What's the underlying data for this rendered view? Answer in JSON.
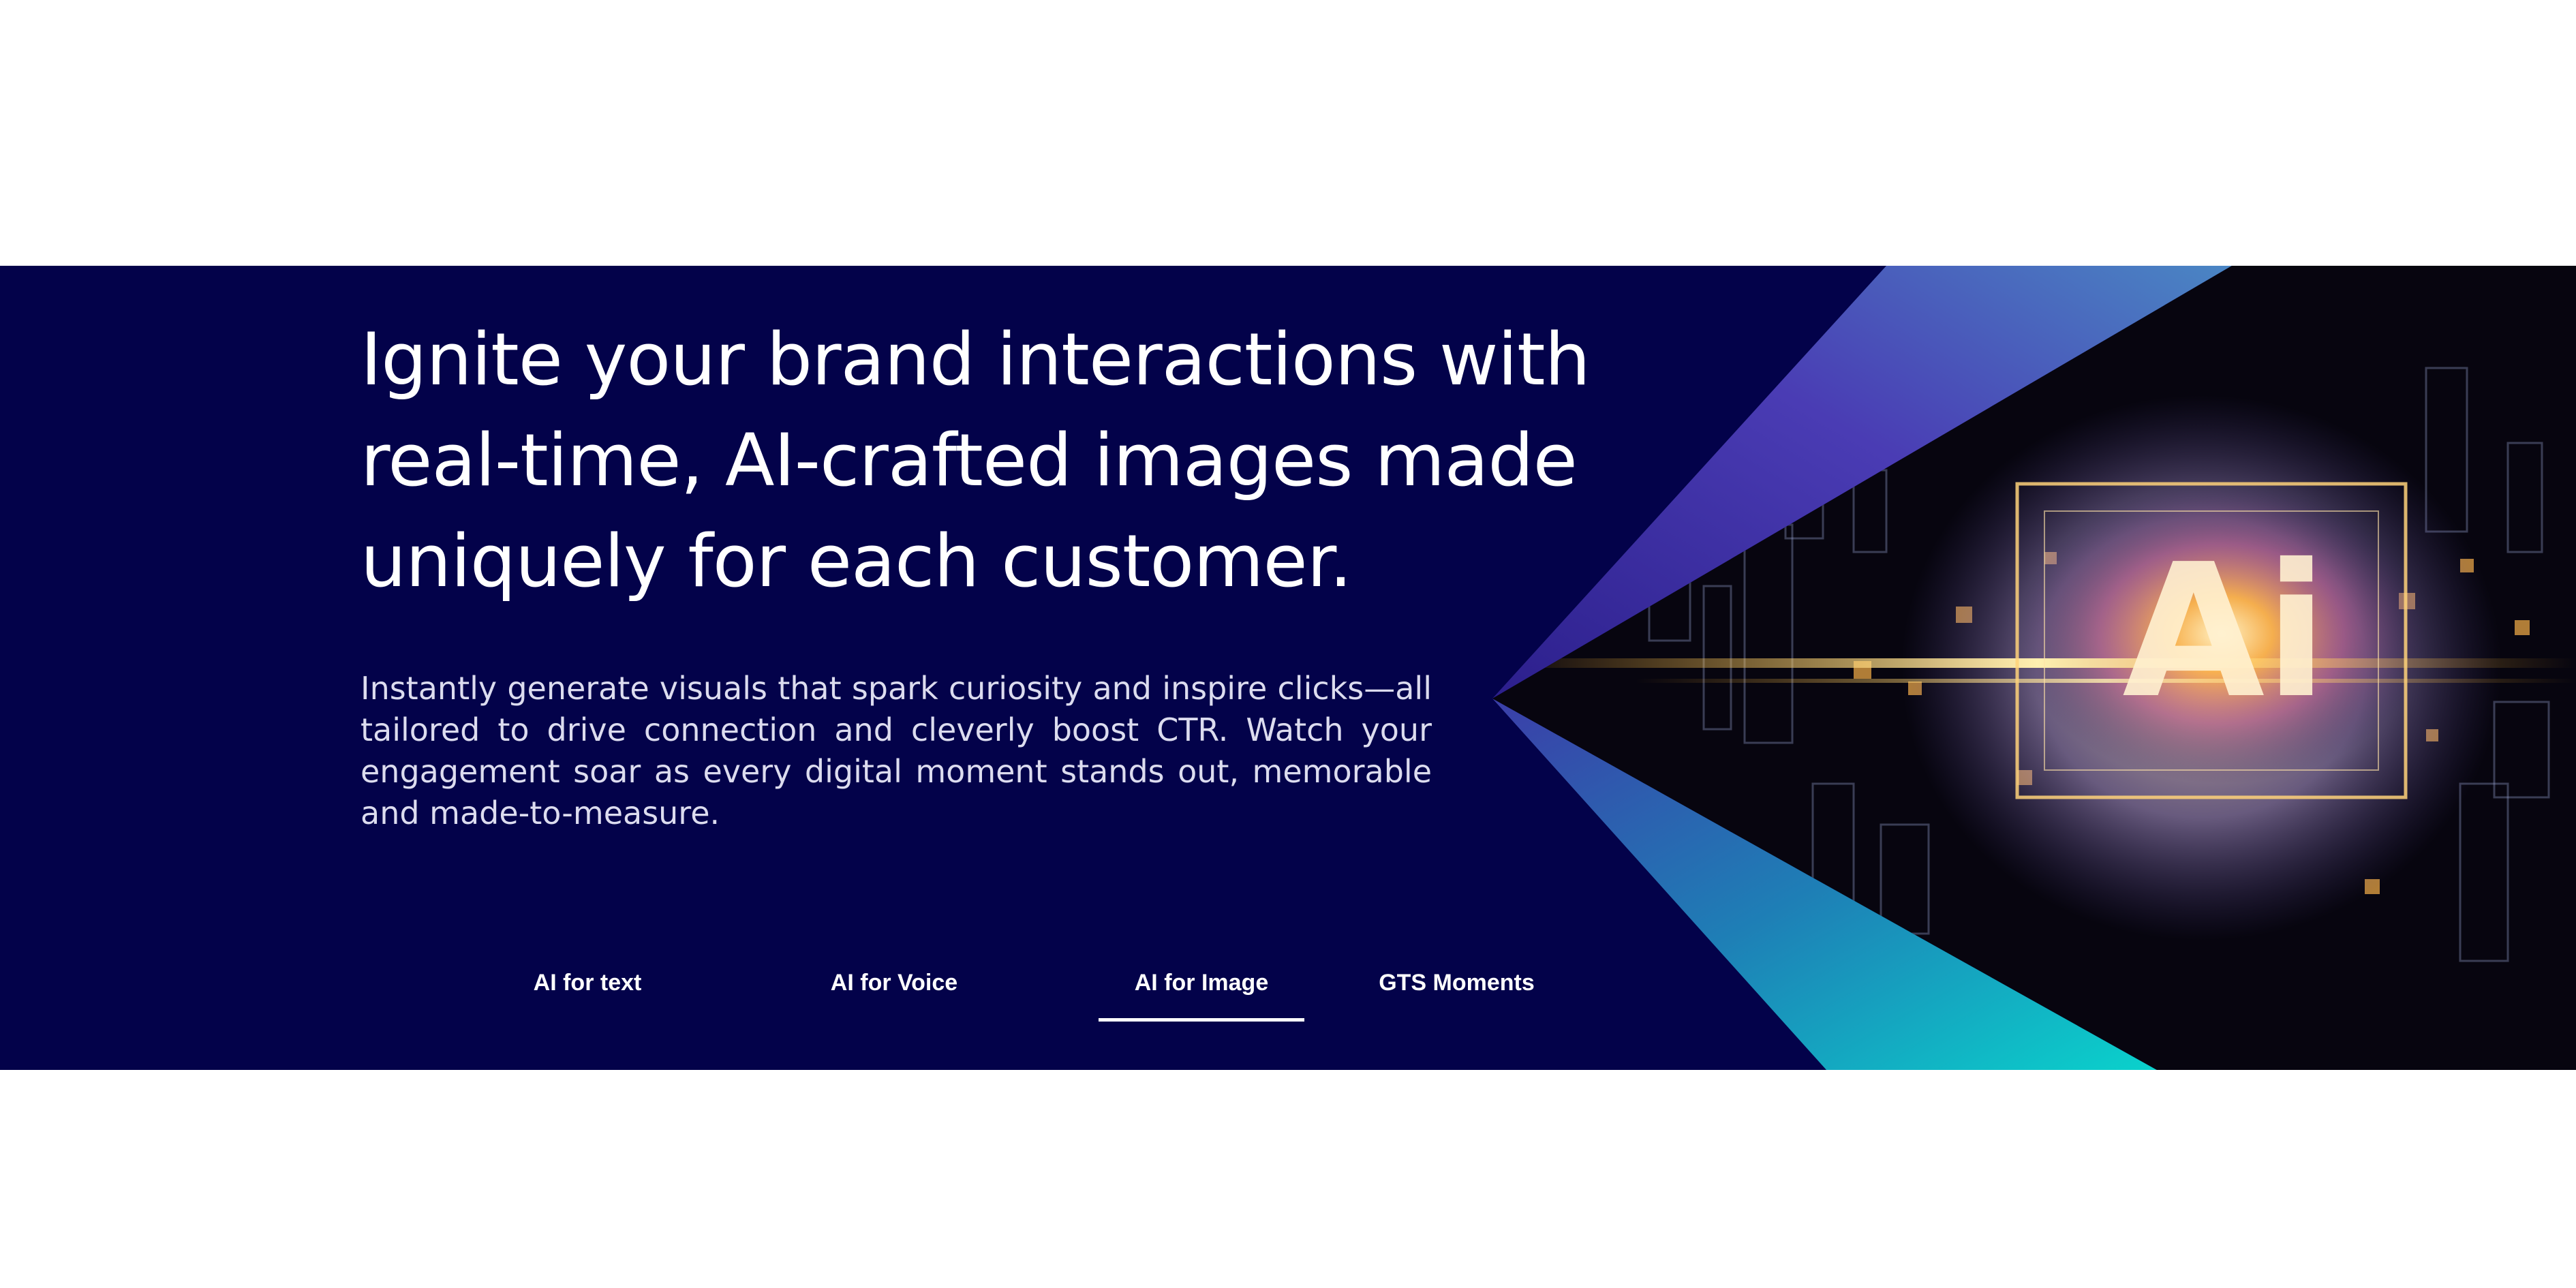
{
  "hero": {
    "headline": "Ignite your brand interactions with real-time, AI-crafted images made uniquely for each customer.",
    "description": "Instantly generate visuals that spark curiosity and inspire clicks—all tailored to drive connection and cleverly boost CTR. Watch your engagement soar as every digital moment stands out, memorable and made-to-measure.",
    "image_text": "Ai",
    "image_icon": "ai-chip-explosion-illustration"
  },
  "tabs": [
    {
      "label": "AI for text",
      "active": false
    },
    {
      "label": "AI for Voice",
      "active": false
    },
    {
      "label": "AI for Image",
      "active": true
    },
    {
      "label": "GTS Moments",
      "active": false
    }
  ],
  "colors": {
    "background": "#03024a",
    "accent_top": "#5a48c8",
    "accent_bottom": "#0ad2c8",
    "glow": "#ffcc66"
  }
}
